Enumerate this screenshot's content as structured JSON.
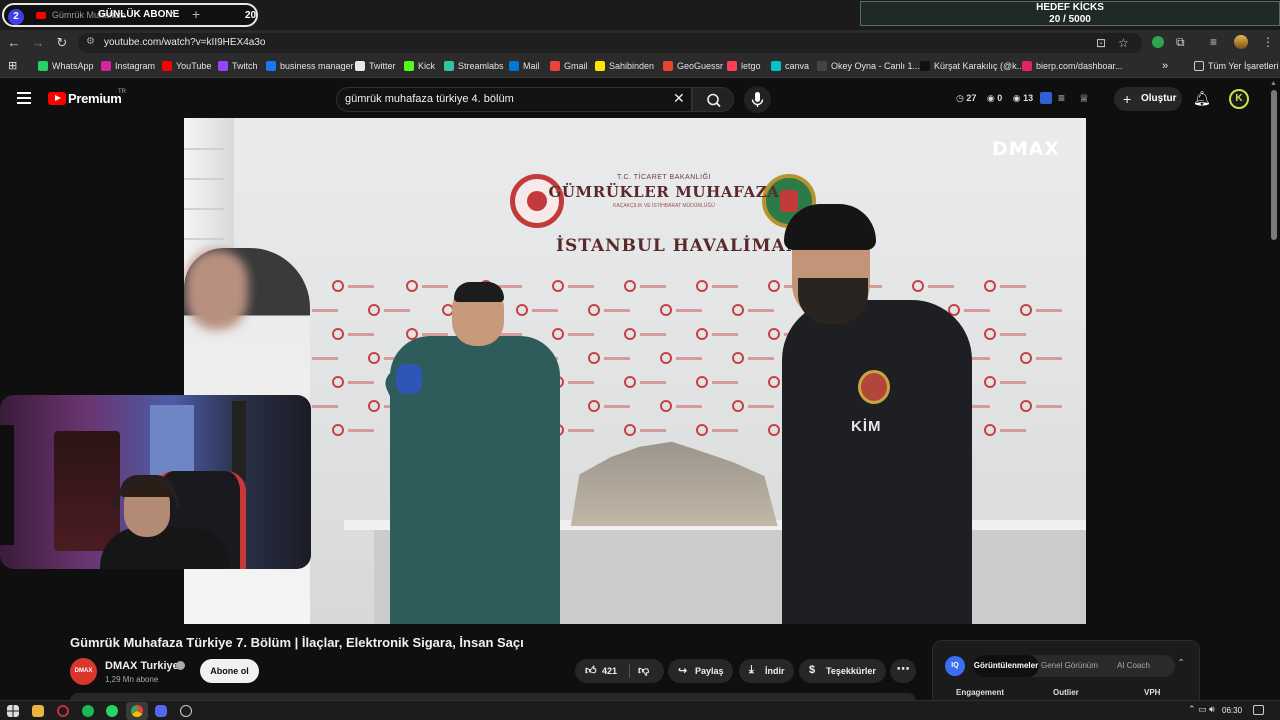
{
  "browser": {
    "tab_group_count": "2",
    "tab_title": "Gümrük Muhafaza",
    "tab_overlay_text": "GÜNLÜK ABONE",
    "tab_close": "×",
    "new_tab": "+",
    "tab_counter": "20",
    "url": "youtube.com/watch?v=kII9HEX4a3o"
  },
  "stream_overlay": {
    "goal_title": "HEDEF KİCKS",
    "goal_value": "20 / 5000"
  },
  "bookmarks": [
    {
      "label": "WhatsApp",
      "color": "#25d366"
    },
    {
      "label": "Instagram",
      "color": "#d6249f"
    },
    {
      "label": "YouTube",
      "color": "#ff0000"
    },
    {
      "label": "Twitch",
      "color": "#9146ff"
    },
    {
      "label": "business manager",
      "color": "#1877f2"
    },
    {
      "label": "Twitter",
      "color": "#e7e7e7"
    },
    {
      "label": "Kick",
      "color": "#53fc18"
    },
    {
      "label": "Streamlabs",
      "color": "#31c3a2"
    },
    {
      "label": "Mail",
      "color": "#0078d4"
    },
    {
      "label": "Gmail",
      "color": "#ea4335"
    },
    {
      "label": "Sahibinden",
      "color": "#ffe800"
    },
    {
      "label": "GeoGuessr",
      "color": "#e8452c"
    },
    {
      "label": "letgo",
      "color": "#ff3f55"
    },
    {
      "label": "canva",
      "color": "#00c4cc"
    },
    {
      "label": "Okey Oyna - Canlı 1...",
      "color": "#444444"
    },
    {
      "label": "Kürşat Karakılıç (@k...",
      "color": "#111111"
    },
    {
      "label": "bierp.com/dashboar...",
      "color": "#e0245e"
    }
  ],
  "bookmarks_more": "»",
  "bookmarks_all": "Tüm Yer İşaretleri",
  "youtube": {
    "logo_text": "Premium",
    "logo_country": "TR",
    "search_value": "gümrük muhafaza türkiye 4. bölüm",
    "search_clear": "✕",
    "stats": {
      "a": "27",
      "b": "0",
      "c": "13"
    },
    "create_plus": "+",
    "create_label": "Oluştur",
    "avatar_letter": "K"
  },
  "video": {
    "watermark": "DMAX",
    "banner_ministry": "T.C. TİCARET BAKANLIĞI",
    "banner_org": "GÜMRÜKLER MUHAFAZA",
    "banner_sub": "KAÇAKÇILIK VE İSTİHBARAT MÜDÜRLÜĞÜ",
    "banner_location": "İSTANBUL HAVALİMANI",
    "vest_text": "KİM",
    "title": "Gümrük Muhafaza Türkiye 7. Bölüm | İlaçlar, Elektronik Sigara, İnsan Saçı"
  },
  "channel": {
    "avatar_text": "DMAX",
    "name": "DMAX Turkiye",
    "subscribers": "1,29 Mn abone",
    "subscribe_label": "Abone ol"
  },
  "actions": {
    "likes": "421",
    "share": "Paylaş",
    "download": "İndir",
    "thanks": "Teşekkürler",
    "more": "⋯"
  },
  "vidiq": {
    "logo": "IQ",
    "tabs": [
      "Görüntülenmeler",
      "Genel Görünüm",
      "AI Coach"
    ],
    "columns": [
      "Engagement",
      "Outlier",
      "VPH"
    ]
  },
  "taskbar": {
    "clock": "06:30"
  }
}
